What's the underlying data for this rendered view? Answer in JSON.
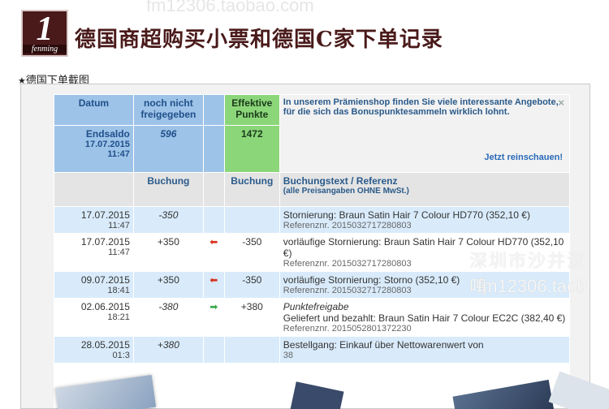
{
  "header": {
    "logo_number": "1",
    "logo_brand": "fenming",
    "title": "德国商超购买小票和德国C家下单记录",
    "watermark_top": "fm12306.taobao.com"
  },
  "section": {
    "star": "★",
    "label": "德国下单截图"
  },
  "summary": {
    "col_datum": "Datum",
    "col_noch": "noch nicht freigegeben",
    "col_eff": "Effektive Punkte",
    "info_text": "In unserem Prämienshop finden Sie viele interessante Angebote, für die sich das Bonuspunktesammeln wirklich lohnt.",
    "info_link": "Jetzt reinschauen!",
    "endsaldo_label": "Endsaldo",
    "endsaldo_date": "17.07.2015",
    "endsaldo_time": "11:47",
    "noch_value": "596",
    "eff_value": "1472"
  },
  "table": {
    "col_buchung1": "Buchung",
    "col_buchung2": "Buchung",
    "col_text": "Buchungstext / Referenz",
    "col_text_sub": "(alle Preisangaben OHNE MwSt.)",
    "rows": [
      {
        "date": "17.07.2015",
        "time": "11:47",
        "buchung": "-350",
        "arrow": "",
        "buchung2": "",
        "italic_title": "",
        "text": "Stornierung: Braun Satin Hair 7 Colour HD770 (352,10 €)",
        "ref": "Referenznr. 2015032717280803"
      },
      {
        "date": "17.07.2015",
        "time": "11:47",
        "buchung": "+350",
        "arrow": "⬅",
        "buchung2": "-350",
        "italic_title": "",
        "text": "vorläufige Stornierung: Braun Satin Hair 7 Colour HD770 (352,10 €)",
        "ref": "Referenznr. 2015032717280803"
      },
      {
        "date": "09.07.2015",
        "time": "18:41",
        "buchung": "+350",
        "arrow": "⬅",
        "buchung2": "-350",
        "italic_title": "",
        "text": "vorläufige Stornierung: Storno (352,10 €)",
        "ref": "Referenznr. 2015032717280803"
      },
      {
        "date": "02.06.2015",
        "time": "18:21",
        "buchung": "-380",
        "arrow": "➡",
        "buchung2": "+380",
        "italic_title": "Punktefreigabe",
        "text": "Geliefert und bezahlt: Braun Satin Hair 7 Colour EC2C (382,40 €)",
        "ref": "Referenznr. 2015052801372230"
      },
      {
        "date": "28.05.2015",
        "time": "01:3",
        "buchung": "+380",
        "arrow": "",
        "buchung2": "",
        "italic_title": "",
        "text": "Bestellgang: Einkauf über Nettowarenwert von",
        "ref": "38"
      }
    ]
  },
  "watermark_cn": "深圳市沙井汉鸣",
  "watermark_url": "fm12306.taob",
  "close": "×",
  "colors": {
    "brand": "#4a1a1a",
    "header_blue": "#9ec3e8",
    "header_green": "#8cd67a",
    "row_blue": "#d9ebfb",
    "arrow_red": "#d8321f",
    "arrow_green": "#3aa84a"
  }
}
